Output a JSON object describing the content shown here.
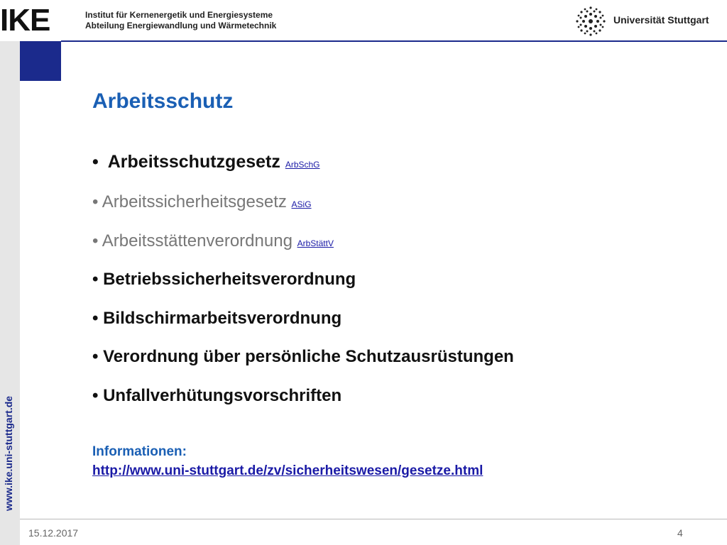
{
  "header": {
    "logo_text": "IKE",
    "institute_line1": "Institut für Kernenergetik und Energiesysteme",
    "institute_line2": "Abteilung Energiewandlung und Wärmetechnik",
    "university": "Universität Stuttgart",
    "brand_blue": "#1b2a8c"
  },
  "sidebar": {
    "url": "www.ike.uni-stuttgart.de"
  },
  "slide": {
    "title": "Arbeitsschutz",
    "bullets": [
      {
        "text": "Arbeitsschutzgesetz",
        "link": "ArbSchG"
      },
      {
        "text": "Arbeitssicherheitsgesetz",
        "link": " ASiG"
      },
      {
        "text": "Arbeitsstättenverordnung",
        "link": "ArbStättV"
      },
      {
        "text": "Betriebssicherheitsverordnung"
      },
      {
        "text": "Bildschirmarbeitsverordnung"
      },
      {
        "text": "Verordnung über persönliche Schutzausrüstungen"
      },
      {
        "text": "Unfallverhütungsvorschriften"
      }
    ],
    "info_label": "Informationen:",
    "info_link": "http://www.uni-stuttgart.de/zv/sicherheitswesen/gesetze.html"
  },
  "footer": {
    "date": "15.12.2017",
    "page": "4"
  }
}
